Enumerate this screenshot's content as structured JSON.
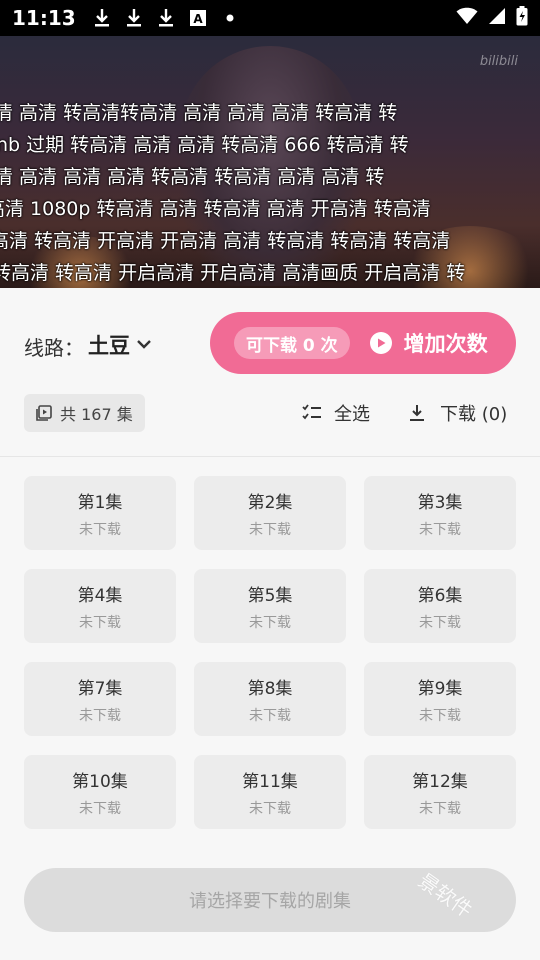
{
  "status_bar": {
    "time": "11:13",
    "icons": [
      "download-icon",
      "download-icon",
      "download-icon",
      "font-a-icon",
      "dot-icon"
    ],
    "right_icons": [
      "wifi-icon",
      "signal-icon",
      "battery-charging-icon"
    ]
  },
  "video": {
    "logo_text": "bilibili",
    "danmaku": [
      "清 高清 转高清转高清 高清 高清 高清 转高清 转",
      "nb 过期 转高清 高清 高清 转高清 666 转高清 转",
      "清 高清 高清 高清 转高清 转高清 高清 高清 转",
      "高清 1080p 转高清 高清 转高清 高清 开高清 转高清",
      "高清 转高清 开高清 开高清 高清 转高清 转高清 转高清",
      "转高清 转高清 开启高清 开启高清 高清画质 开启高清 转"
    ]
  },
  "route": {
    "label": "线路：",
    "value": "土豆"
  },
  "download_quota": {
    "pill": "可下载 0 次",
    "action": "增加次数"
  },
  "toolbar": {
    "count": "共 167 集",
    "select_all": "全选",
    "download": "下载 (0)"
  },
  "episodes": [
    {
      "title": "第1集",
      "status": "未下载"
    },
    {
      "title": "第2集",
      "status": "未下载"
    },
    {
      "title": "第3集",
      "status": "未下载"
    },
    {
      "title": "第4集",
      "status": "未下载"
    },
    {
      "title": "第5集",
      "status": "未下载"
    },
    {
      "title": "第6集",
      "status": "未下载"
    },
    {
      "title": "第7集",
      "status": "未下载"
    },
    {
      "title": "第8集",
      "status": "未下载"
    },
    {
      "title": "第9集",
      "status": "未下载"
    },
    {
      "title": "第10集",
      "status": "未下载"
    },
    {
      "title": "第11集",
      "status": "未下载"
    },
    {
      "title": "第12集",
      "status": "未下载"
    }
  ],
  "confirm": {
    "label": "请选择要下载的剧集"
  },
  "watermark": "景软件",
  "colors": {
    "accent": "#f16b95",
    "accent_light": "#f69bb8",
    "button_disabled": "#dcdcdc"
  }
}
